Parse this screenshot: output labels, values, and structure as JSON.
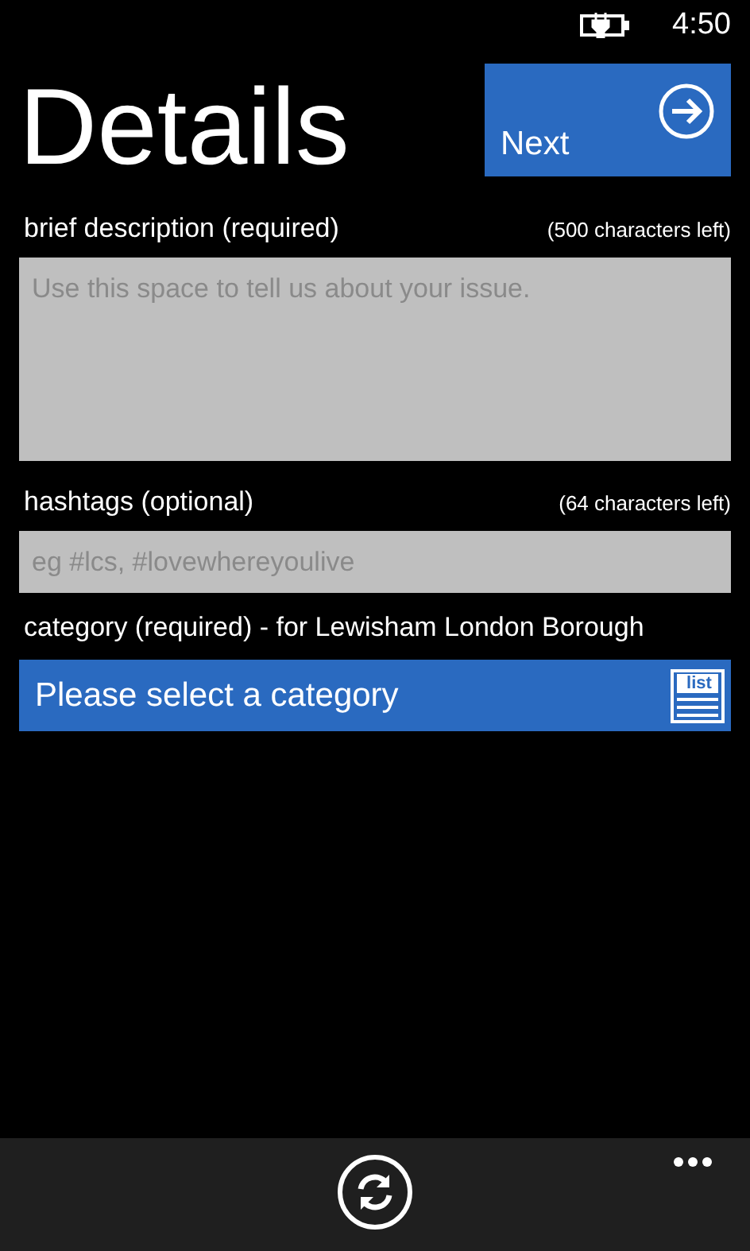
{
  "status_bar": {
    "time": "4:50"
  },
  "title": "Details",
  "next_button": {
    "label": "Next"
  },
  "description": {
    "label": "brief description (required)",
    "counter": "(500 characters left)",
    "placeholder": "Use this space to tell us about your issue."
  },
  "hashtags": {
    "label": "hashtags (optional)",
    "counter": "(64 characters left)",
    "placeholder": "eg #lcs, #lovewhereyoulive"
  },
  "category": {
    "label": "category (required)  - for Lewisham London Borough",
    "value": "Please select a category",
    "icon_label": "list"
  }
}
